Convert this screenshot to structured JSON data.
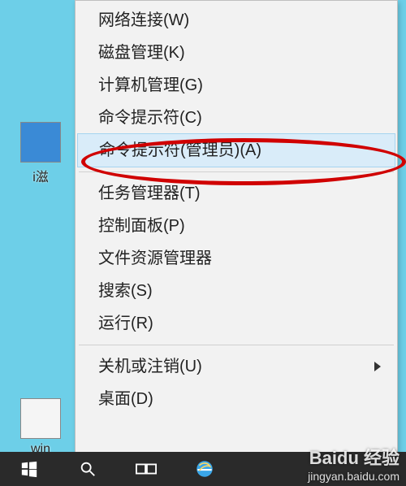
{
  "desktop": {
    "icon1_label": "i滋",
    "icon2_label": "win"
  },
  "menu": {
    "items": [
      {
        "label": "网络连接(W)",
        "sep_after": false,
        "has_sub": false,
        "hover": false
      },
      {
        "label": "磁盘管理(K)",
        "sep_after": false,
        "has_sub": false,
        "hover": false
      },
      {
        "label": "计算机管理(G)",
        "sep_after": false,
        "has_sub": false,
        "hover": false
      },
      {
        "label": "命令提示符(C)",
        "sep_after": false,
        "has_sub": false,
        "hover": false
      },
      {
        "label": "命令提示符(管理员)(A)",
        "sep_after": true,
        "has_sub": false,
        "hover": true
      },
      {
        "label": "任务管理器(T)",
        "sep_after": false,
        "has_sub": false,
        "hover": false
      },
      {
        "label": "控制面板(P)",
        "sep_after": false,
        "has_sub": false,
        "hover": false
      },
      {
        "label": "文件资源管理器",
        "sep_after": false,
        "has_sub": false,
        "hover": false
      },
      {
        "label": "搜索(S)",
        "sep_after": false,
        "has_sub": false,
        "hover": false
      },
      {
        "label": "运行(R)",
        "sep_after": true,
        "has_sub": false,
        "hover": false
      },
      {
        "label": "关机或注销(U)",
        "sep_after": false,
        "has_sub": true,
        "hover": false
      },
      {
        "label": "桌面(D)",
        "sep_after": false,
        "has_sub": false,
        "hover": false
      }
    ]
  },
  "watermark": {
    "main": "Baidu 经验",
    "sub": "jingyan.baidu.com"
  }
}
